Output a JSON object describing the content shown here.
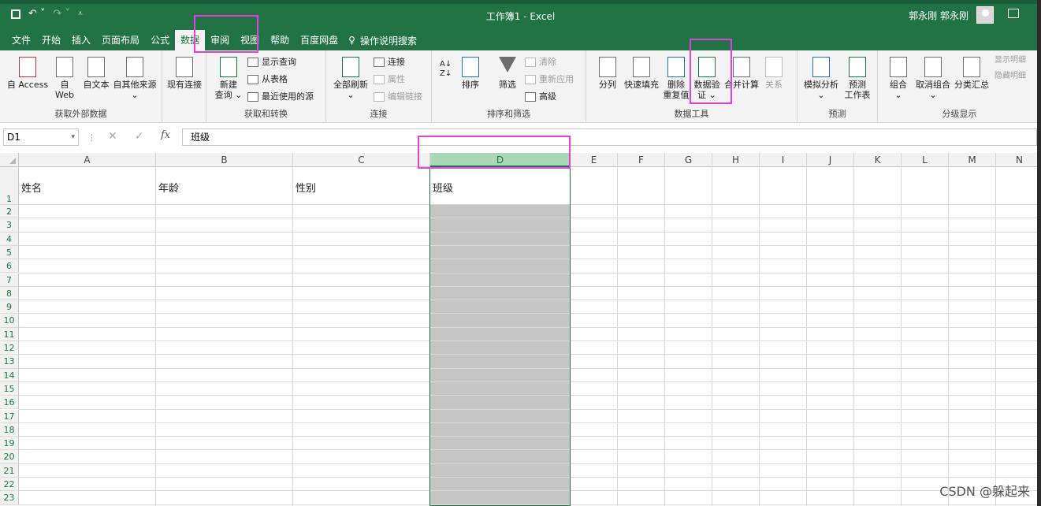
{
  "app": {
    "title": "工作簿1  -  Excel",
    "user_name": "郭永刚 郭永刚"
  },
  "qat": {
    "save_icon": "save-icon",
    "undo_icon": "undo-icon",
    "redo_icon": "redo-icon",
    "customize_icon": "customize-icon"
  },
  "tabs": [
    {
      "label": "文件"
    },
    {
      "label": "开始"
    },
    {
      "label": "插入"
    },
    {
      "label": "页面布局"
    },
    {
      "label": "公式"
    },
    {
      "label": "数据",
      "active": true
    },
    {
      "label": "审阅"
    },
    {
      "label": "视图"
    },
    {
      "label": "帮助"
    },
    {
      "label": "百度网盘"
    }
  ],
  "tellme": {
    "label": "操作说明搜索"
  },
  "ribbon": {
    "get_external": {
      "label": "获取外部数据",
      "access": "自 Access",
      "web1": "自",
      "web2": "Web",
      "text": "自文本",
      "other": "自其他来源",
      "other_dd": "⌄",
      "existing": "现有连接"
    },
    "get_transform": {
      "label": "获取和转换",
      "new_query1": "新建",
      "new_query2": "查询 ⌄",
      "show_queries": "显示查询",
      "from_table": "从表格",
      "recent_sources": "最近使用的源"
    },
    "connections": {
      "label": "连接",
      "refresh_all": "全部刷新",
      "refresh_dd": "⌄",
      "connections": "连接",
      "properties": "属性",
      "edit_links": "编辑链接"
    },
    "sort_filter": {
      "label": "排序和筛选",
      "sort": "排序",
      "filter": "筛选",
      "clear": "清除",
      "reapply": "重新应用",
      "advanced": "高级"
    },
    "data_tools": {
      "label": "数据工具",
      "text_to_columns": "分列",
      "flash_fill": "快速填充",
      "remove_dup1": "删除",
      "remove_dup2": "重复值",
      "validation1": "数据验",
      "validation2": "证 ⌄",
      "consolidate": "合并计算",
      "relationships": "关系"
    },
    "forecast": {
      "label": "预测",
      "whatif": "模拟分析",
      "whatif_dd": "⌄",
      "forecast1": "预测",
      "forecast2": "工作表"
    },
    "outline": {
      "label": "分级显示",
      "group": "组合",
      "ungroup": "取消组合",
      "subtotal": "分类汇总",
      "dd": "⌄",
      "show_detail": "显示明细",
      "hide_detail": "隐藏明细"
    }
  },
  "formula_bar": {
    "name_box": "D1",
    "fx": "fx",
    "value": "班级"
  },
  "columns": [
    "A",
    "B",
    "C",
    "D",
    "E",
    "F",
    "G",
    "H",
    "I",
    "J",
    "K",
    "L",
    "M",
    "N"
  ],
  "rows": [
    "1",
    "2",
    "3",
    "4",
    "5",
    "6",
    "7",
    "8",
    "9",
    "10",
    "11",
    "12",
    "13",
    "14",
    "15",
    "16",
    "17",
    "18",
    "19",
    "20",
    "21",
    "22",
    "23"
  ],
  "cells": {
    "A1": "姓名",
    "B1": "年龄",
    "C1": "性别",
    "D1": "班级"
  },
  "selected_column": "D",
  "highlight_color": "#e040e0",
  "accent_color": "#217346",
  "watermark": "CSDN @躲起来"
}
